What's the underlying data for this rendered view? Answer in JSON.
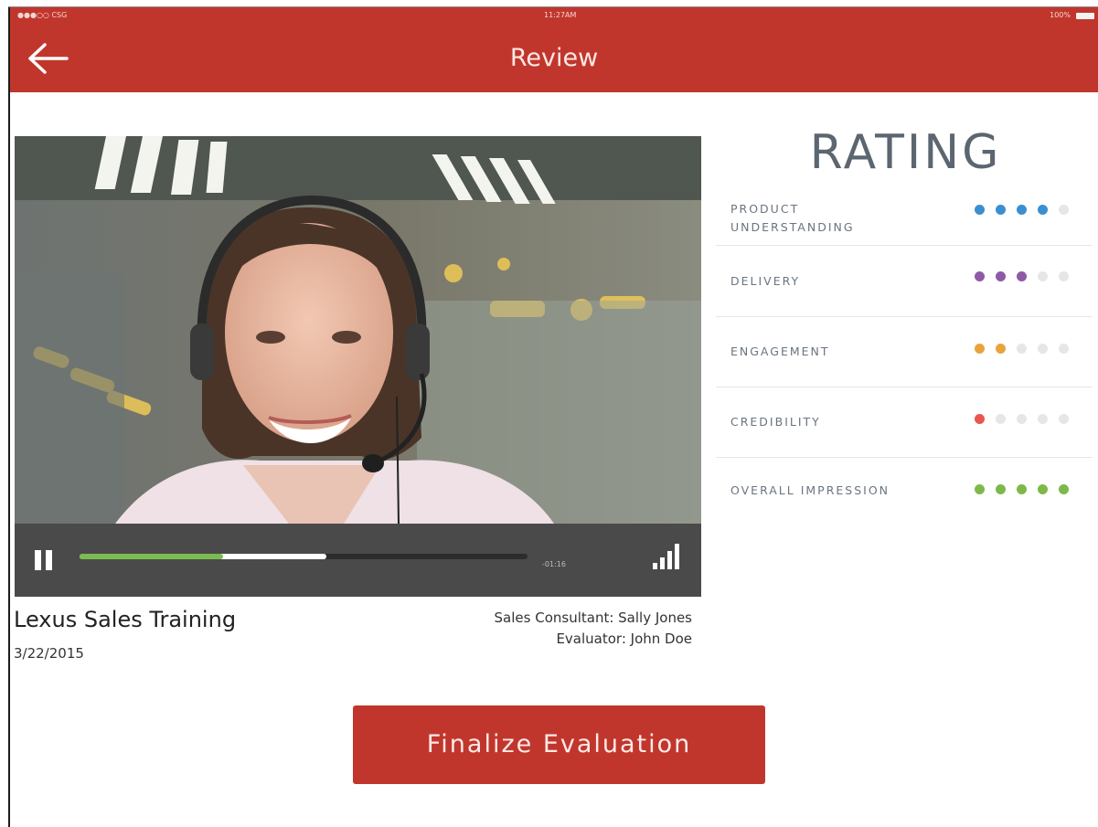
{
  "status_bar": {
    "carrier": "●●●○○ CSG",
    "time": "11:27AM",
    "battery": "100%"
  },
  "header": {
    "title": "Review",
    "back_icon": "arrow-left-icon"
  },
  "video": {
    "player_icons": [
      "pause-icon",
      "signal-bars-icon"
    ],
    "time_remaining": "-01:16",
    "progress_played": 0.32,
    "progress_buffered": 0.55
  },
  "session": {
    "title": "Lexus Sales Training",
    "date": "3/22/2015",
    "consultant": "Sales Consultant: Sally Jones",
    "evaluator": "Evaluator: John Doe"
  },
  "rating": {
    "heading": "RATING",
    "categories": [
      {
        "label": "PRODUCT\nUNDERSTANDING",
        "score": 4,
        "max": 5,
        "color": "#3a8fd0"
      },
      {
        "label": "DELIVERY",
        "score": 3,
        "max": 5,
        "color": "#8e5aa8"
      },
      {
        "label": "ENGAGEMENT",
        "score": 2,
        "max": 5,
        "color": "#e9a33d"
      },
      {
        "label": "CREDIBILITY",
        "score": 1,
        "max": 5,
        "color": "#e8574f"
      },
      {
        "label": "OVERALL IMPRESSION",
        "score": 5,
        "max": 5,
        "color": "#7cb94a"
      }
    ]
  },
  "actions": {
    "finalize_label": "Finalize Evaluation"
  },
  "colors": {
    "brand": "#c1362c",
    "inactive_dot": "#e6e6e6"
  }
}
